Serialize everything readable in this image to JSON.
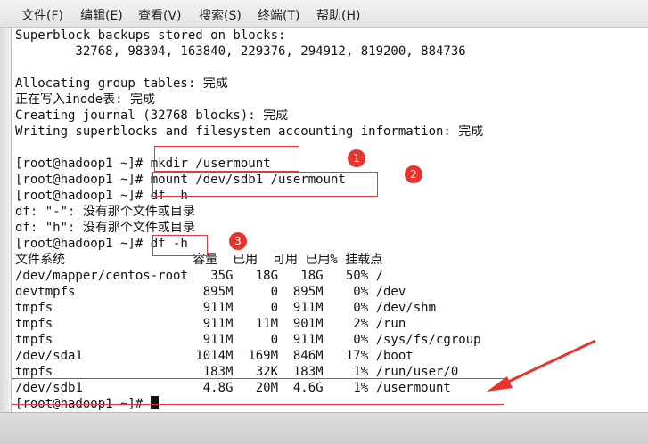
{
  "menu": {
    "file": "文件(F)",
    "edit": "编辑(E)",
    "view": "查看(V)",
    "search": "搜索(S)",
    "terminal": "终端(T)",
    "help": "帮助(H)"
  },
  "terminal_lines": [
    "Superblock backups stored on blocks:",
    "        32768, 98304, 163840, 229376, 294912, 819200, 884736",
    "",
    "Allocating group tables: 完成",
    "正在写入inode表: 完成",
    "Creating journal (32768 blocks): 完成",
    "Writing superblocks and filesystem accounting information: 完成",
    "",
    "[root@hadoop1 ~]# mkdir /usermount",
    "[root@hadoop1 ~]# mount /dev/sdb1 /usermount",
    "[root@hadoop1 ~]# df  h",
    "df: \"-\": 没有那个文件或目录",
    "df: \"h\": 没有那个文件或目录",
    "[root@hadoop1 ~]# df -h",
    "文件系统                 容量  已用  可用 已用% 挂载点",
    "/dev/mapper/centos-root   35G   18G   18G   50% /",
    "devtmpfs                 895M     0  895M    0% /dev",
    "tmpfs                    911M     0  911M    0% /dev/shm",
    "tmpfs                    911M   11M  901M    2% /run",
    "tmpfs                    911M     0  911M    0% /sys/fs/cgroup",
    "/dev/sda1               1014M  169M  846M   17% /boot",
    "tmpfs                    183M   32K  183M    1% /run/user/0",
    "/dev/sdb1                4.8G   20M  4.6G    1% /usermount",
    "[root@hadoop1 ~]# "
  ],
  "annotations": {
    "badge1": "1",
    "badge2": "2",
    "badge3": "3"
  },
  "colors": {
    "annotation_red": "#e03a3a",
    "badge_red": "#e8332e",
    "text": "#111111",
    "background": "#ffffff"
  }
}
